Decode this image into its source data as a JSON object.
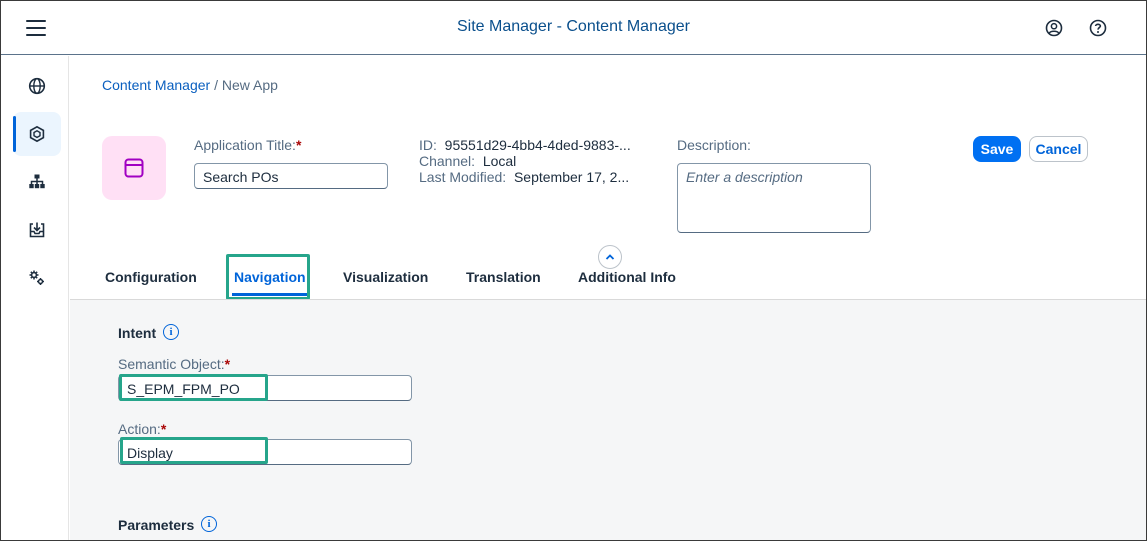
{
  "shell": {
    "title": "Site Manager - Content Manager",
    "menu_icon": "menu-icon",
    "user_icon": "user-icon",
    "help_icon": "help-icon"
  },
  "sidenav": {
    "items": [
      {
        "name": "globe-icon",
        "active": false
      },
      {
        "name": "content-manager-icon",
        "active": true
      },
      {
        "name": "hierarchy-icon",
        "active": false
      },
      {
        "name": "download-box-icon",
        "active": false
      },
      {
        "name": "settings-icon",
        "active": false
      }
    ]
  },
  "breadcrumb": {
    "link": "Content Manager",
    "separator": " / ",
    "current": "New App"
  },
  "header": {
    "app_icon": "window-icon",
    "title_label": "Application Title:",
    "title_required": "*",
    "title_value": "Search POs",
    "id_label": "ID:",
    "id_value": "95551d29-4bb4-4ded-9883-...",
    "channel_label": "Channel:",
    "channel_value": "Local",
    "modified_label": "Last Modified:",
    "modified_value": "September 17, 2...",
    "description_label": "Description:",
    "description_placeholder": "Enter a description",
    "save_label": "Save",
    "cancel_label": "Cancel",
    "collapse_icon": "chevron-up-icon"
  },
  "tabs": [
    {
      "label": "Configuration",
      "selected": false
    },
    {
      "label": "Navigation",
      "selected": true
    },
    {
      "label": "Visualization",
      "selected": false
    },
    {
      "label": "Translation",
      "selected": false
    },
    {
      "label": "Additional Info",
      "selected": false
    }
  ],
  "navigation": {
    "intent_title": "Intent",
    "semantic_object_label": "Semantic Object:",
    "semantic_object_required": "*",
    "semantic_object_value": "S_EPM_FPM_PO",
    "action_label": "Action:",
    "action_required": "*",
    "action_value": "Display",
    "parameters_title": "Parameters"
  },
  "colors": {
    "accent": "#0070f2",
    "highlight": "#26a58b",
    "app_icon_bg": "#ffe0f5",
    "app_icon_fg": "#a100c2"
  }
}
